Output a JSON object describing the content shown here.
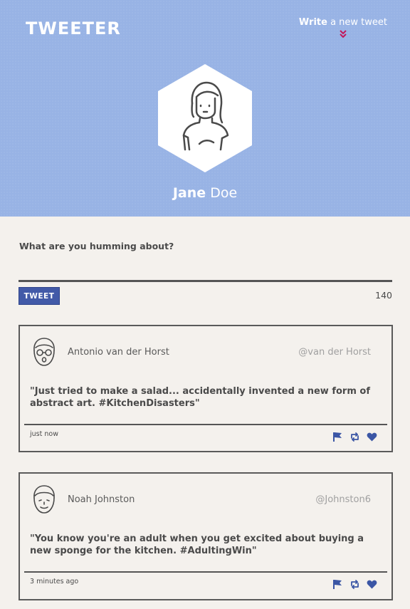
{
  "header": {
    "logo": "TWEETER",
    "write_bold": "Write",
    "write_rest": " a new tweet",
    "first_name": "Jane",
    "last_name": "Doe"
  },
  "composer": {
    "prompt": "What are you humming about?",
    "value": "",
    "button_label": "TWEET",
    "char_count": "140"
  },
  "tweets": [
    {
      "author": "Antonio van der Horst",
      "handle": "@van der Horst",
      "text": "\"Just tried to make a salad... accidentally invented a new form of abstract art. #KitchenDisasters\"",
      "time": "just now",
      "avatar_icon": "man-glasses-avatar-icon"
    },
    {
      "author": "Noah Johnston",
      "handle": "@Johnston6",
      "text": "\"You know you're an adult when you get excited about buying a new sponge for the kitchen. #AdultingWin\"",
      "time": "3 minutes ago",
      "avatar_icon": "man-avatar-icon"
    }
  ],
  "colors": {
    "header_bg": "#98b3e5",
    "page_bg": "#f4f1ed",
    "accent_blue": "#425aa8",
    "chevron": "#c2185b"
  }
}
